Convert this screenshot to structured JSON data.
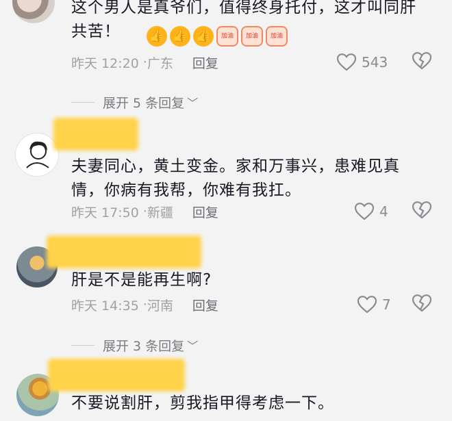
{
  "comments": [
    {
      "text": "这个男人是真爷们，值得终身托付，这才叫同肝共苦！",
      "emojis": [
        "thumbs-up",
        "thumbs-up",
        "thumbs-up",
        "jiayou",
        "jiayou",
        "jiayou"
      ],
      "emoji_label": "加油",
      "time": "昨天 12:20",
      "region": "广东",
      "reply_label": "回复",
      "likes": "543"
    },
    {
      "text": "夫妻同心，黄土变金。家和万事兴，患难见真情，你病有我帮，你难有我扛。",
      "time": "昨天 17:50",
      "region": "新疆",
      "reply_label": "回复",
      "likes": "4"
    },
    {
      "text": "肝是不是能再生啊?",
      "time": "昨天 14:35",
      "region": "河南",
      "reply_label": "回复",
      "likes": "7"
    },
    {
      "text": "不要说割肝，剪我指甲得考虑一下。"
    }
  ],
  "expand_replies": [
    {
      "label": "展开 5 条回复"
    },
    {
      "label": "展开 3 条回复"
    }
  ],
  "colors": {
    "redaction": "#ffd24a",
    "background": "#f3f3f3",
    "meta": "#a0a0a5"
  }
}
